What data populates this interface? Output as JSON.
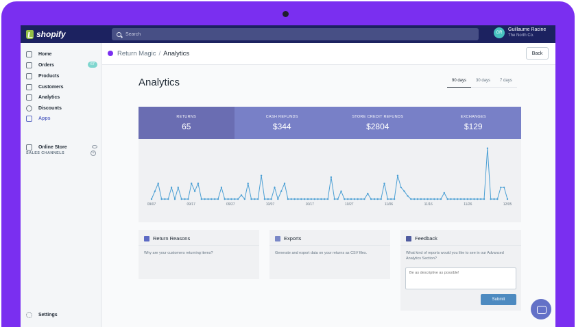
{
  "topbar": {
    "logo": "shopify",
    "search_placeholder": "Search",
    "user_initials": "GR",
    "user_name": "Guillaume Racine",
    "user_store": "The North Co."
  },
  "sidebar": {
    "items": [
      {
        "label": "Home",
        "icon": "home-icon"
      },
      {
        "label": "Orders",
        "icon": "orders-icon",
        "badge": "67"
      },
      {
        "label": "Products",
        "icon": "tag-icon"
      },
      {
        "label": "Customers",
        "icon": "person-icon"
      },
      {
        "label": "Analytics",
        "icon": "bar-chart-icon"
      },
      {
        "label": "Discounts",
        "icon": "discount-icon"
      },
      {
        "label": "Apps",
        "icon": "apps-icon",
        "active": true
      }
    ],
    "channels_label": "SALES CHANNELS",
    "online_store": "Online Store",
    "settings": "Settings"
  },
  "appbar": {
    "app_name": "Return Magic",
    "separator": "/",
    "current": "Analytics",
    "back_label": "Back"
  },
  "page": {
    "title": "Analytics",
    "range_tabs": [
      "90 days",
      "30 days",
      "7 days"
    ],
    "selected_range": "90 days"
  },
  "stats": [
    {
      "label": "RETURNS",
      "value": "65",
      "color": "#6a6db2"
    },
    {
      "label": "CASH REFUNDS",
      "value": "$344",
      "color": "#7880c7"
    },
    {
      "label": "STORE CREDIT REFUNDS",
      "value": "$2804",
      "color": "#7880c7"
    },
    {
      "label": "EXCHANGES",
      "value": "$129",
      "color": "#7880c7"
    }
  ],
  "chart_data": {
    "type": "line",
    "x_tick_labels": [
      "09/07",
      "09/17",
      "09/27",
      "10/07",
      "10/17",
      "10/27",
      "11/06",
      "11/16",
      "11/26",
      "12/05"
    ],
    "values": [
      0,
      1,
      2,
      0,
      0,
      0,
      1.5,
      0,
      1.5,
      0,
      0,
      0,
      2,
      1,
      2,
      0,
      0,
      0,
      0,
      0,
      0,
      1.5,
      0,
      0,
      0,
      0,
      0,
      0.5,
      0,
      2,
      0,
      0,
      0,
      3,
      0,
      0,
      0,
      1.5,
      0,
      1,
      2,
      0,
      0,
      0,
      0,
      0,
      0,
      0,
      0,
      0,
      0,
      0,
      0,
      0,
      2.8,
      0,
      0,
      1,
      0,
      0,
      0,
      0,
      0,
      0,
      0,
      0.7,
      0,
      0,
      0,
      0,
      2,
      0,
      0,
      0,
      3,
      1.5,
      1,
      0.4,
      0,
      0,
      0,
      0,
      0,
      0,
      0,
      0,
      0,
      0,
      0.8,
      0,
      0,
      0,
      0,
      0,
      0,
      0,
      0,
      0,
      0,
      0,
      0,
      6.5,
      0,
      0,
      0,
      1.5,
      1.5,
      0
    ],
    "ylim": [
      0,
      7
    ],
    "color": "#4a9fd4"
  },
  "cards": {
    "reasons": {
      "title": "Return Reasons",
      "text": "Why are your customers returning items?"
    },
    "exports": {
      "title": "Exports",
      "text": "Generate and export data on your returns as CSV files."
    },
    "feedback": {
      "title": "Feedback",
      "text": "What kind of reports would you like to see in our Advanced Analytics Section?",
      "placeholder": "Be as descriptive as possible!",
      "submit": "Submit"
    }
  }
}
